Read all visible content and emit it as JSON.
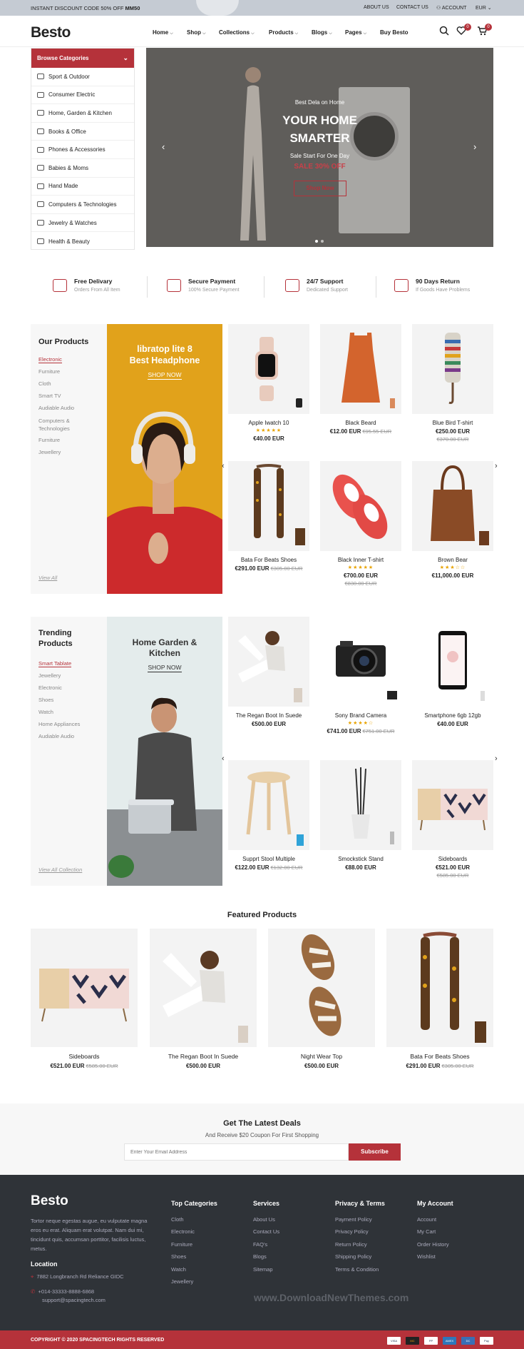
{
  "topbar": {
    "promo_prefix": "INSTANT DISCOUNT CODE 50% OFF",
    "promo_code": "MM50",
    "about": "ABOUT US",
    "contact": "CONTACT US",
    "account": "ACCOUNT",
    "currency": "EUR"
  },
  "header": {
    "logo": "Besto",
    "nav": [
      "Home",
      "Shop",
      "Collections",
      "Products",
      "Blogs",
      "Pages",
      "Buy Besto"
    ],
    "wishlist_count": "0",
    "cart_count": "0"
  },
  "categories": {
    "title": "Browse Categories",
    "items": [
      "Sport & Outdoor",
      "Consumer Electric",
      "Home, Garden & Kitchen",
      "Books & Office",
      "Phones & Accessories",
      "Babies & Moms",
      "Hand Made",
      "Computers & Technologies",
      "Jewelry & Watches",
      "Health & Beauty"
    ]
  },
  "hero": {
    "kicker": "Best Dela on Home",
    "title_line1": "YOUR HOME",
    "title_line2": "SMARTER",
    "sub": "Sale Start For One Day",
    "sale": "SALE 30% OFF",
    "button": "Shop Now"
  },
  "features": [
    {
      "title": "Free Delivary",
      "sub": "Orders From All Item"
    },
    {
      "title": "Secure Payment",
      "sub": "100% Secure Payment"
    },
    {
      "title": "24/7 Support",
      "sub": "Dedicated Support"
    },
    {
      "title": "90 Days Return",
      "sub": "If Goods Have Problems"
    }
  ],
  "our_products": {
    "title": "Our Products",
    "links": [
      "Electronic",
      "Furniture",
      "Cloth",
      "Smart TV",
      "Audiable Audio",
      "Computers & Technologies",
      "Furniture",
      "Jewellery"
    ],
    "view_all": "View All",
    "banner_title_1": "libratop lite 8",
    "banner_title_2": "Best Headphone",
    "banner_shop": "SHOP NOW",
    "products": [
      {
        "name": "Apple Iwatch 10",
        "stars": "★★★★★",
        "price": "€40.00 EUR",
        "old": ""
      },
      {
        "name": "Black Beard",
        "stars": "",
        "price": "€12.00 EUR",
        "old": "€95.55 EUR"
      },
      {
        "name": "Blue Bird T-shirt",
        "stars": "",
        "price": "€250.00 EUR",
        "old": "€370.00 EUR"
      },
      {
        "name": "Bata For Beats Shoes",
        "stars": "",
        "price": "€291.00 EUR",
        "old": "€305.00 EUR"
      },
      {
        "name": "Black Inner T-shirt",
        "stars": "★★★★★",
        "price": "€700.00 EUR",
        "old": "€830.00 EUR"
      },
      {
        "name": "Brown Bear",
        "stars": "★★★☆☆",
        "price": "€11,000.00 EUR",
        "old": ""
      }
    ]
  },
  "trending": {
    "title_line1": "Trending",
    "title_line2": "Products",
    "links": [
      "Smart Tablate",
      "Jewellery",
      "Electronic",
      "Shoes",
      "Watch",
      "Home Appliances",
      "Audiable Audio"
    ],
    "view_all": "View All Collection",
    "banner_title_1": "Home Garden &",
    "banner_title_2": "Kitchen",
    "banner_shop": "SHOP NOW",
    "products": [
      {
        "name": "The Regan Boot In Suede",
        "stars": "",
        "price": "€500.00 EUR",
        "old": ""
      },
      {
        "name": "Sony Brand Camera",
        "stars": "★★★★☆",
        "price": "€741.00 EUR",
        "old": "€751.00 EUR"
      },
      {
        "name": "Smartphone 6gb 12gb",
        "stars": "",
        "price": "€40.00 EUR",
        "old": ""
      },
      {
        "name": "Supprt Stool Multiple",
        "stars": "",
        "price": "€122.00 EUR",
        "old": "€132.00 EUR"
      },
      {
        "name": "Smockstick Stand",
        "stars": "",
        "price": "€88.00 EUR",
        "old": ""
      },
      {
        "name": "Sideboards",
        "stars": "",
        "price": "€521.00 EUR",
        "old": "€585.00 EUR"
      }
    ]
  },
  "featured": {
    "title": "Featured Products",
    "products": [
      {
        "name": "Sideboards",
        "price": "€521.00 EUR",
        "old": "€585.00 EUR"
      },
      {
        "name": "The Regan Boot In Suede",
        "price": "€500.00 EUR",
        "old": ""
      },
      {
        "name": "Night Wear Top",
        "price": "€500.00 EUR",
        "old": ""
      },
      {
        "name": "Bata For Beats Shoes",
        "price": "€291.00 EUR",
        "old": "€305.00 EUR"
      }
    ]
  },
  "newsletter": {
    "title": "Get The Latest Deals",
    "sub": "And Receive $20 Coupon For First Shopping",
    "placeholder": "Enter Your Email Address",
    "button": "Subscribe"
  },
  "footer": {
    "logo": "Besto",
    "about": "Tortor neque egestas augue, eu vulputate magna eros eu erat. Aliquam erat volutpat. Nam dui mi, tincidunt quis, accumsan porttitor, facilisis luctus, metus.",
    "location_title": "Location",
    "address": "7882 Longbranch Rd Reliance GIDC",
    "phone": "+014-33333-8888-6868",
    "email": "support@spacingtech.com",
    "cols": [
      {
        "title": "Top Categories",
        "links": [
          "Cloth",
          "Electronic",
          "Furniture",
          "Shoes",
          "Watch",
          "Jewellery"
        ]
      },
      {
        "title": "Services",
        "links": [
          "About Us",
          "Contact Us",
          "FAQ's",
          "Blogs",
          "Sitemap"
        ]
      },
      {
        "title": "Privacy & Terms",
        "links": [
          "Payment Policy",
          "Privacy Policy",
          "Return Policy",
          "Shipping Policy",
          "Terms & Condition"
        ]
      },
      {
        "title": "My Account",
        "links": [
          "Account",
          "My Cart",
          "Order History",
          "Wishlist"
        ]
      }
    ],
    "watermark": "www.DownloadNewThemes.com",
    "copyright": "COPYRIGHT © 2020 SPACINGTECH RIGHTS RESERVED",
    "payments": [
      "VISA",
      "MC",
      "PP",
      "AMEX",
      "DC",
      "Pay"
    ]
  },
  "colors": {
    "accent": "#b5323a",
    "footer": "#2f3338",
    "topbar": "#c5cbd3"
  }
}
